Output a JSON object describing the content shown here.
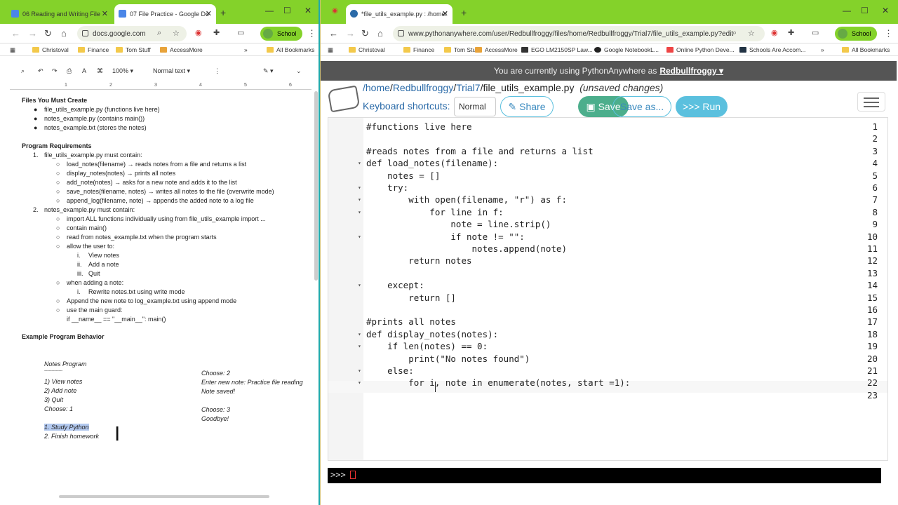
{
  "left": {
    "tabs": [
      {
        "label": "06 Reading and Writing File"
      },
      {
        "label": "07 File Practice - Google Do"
      }
    ],
    "url": "docs.google.com",
    "profile": "School",
    "bookmarks": [
      "Christoval",
      "Finance",
      "Tom Stuff",
      "AccessMore",
      "All Bookmarks"
    ],
    "toolbar": {
      "zoom": "100%",
      "style": "Normal text"
    },
    "ruler": [
      "1",
      "2",
      "3",
      "4",
      "5",
      "6"
    ],
    "doc": {
      "h_files": "Files You Must Create",
      "files": [
        "file_utils_example.py (functions live here)",
        "notes_example.py (contains main())",
        "notes_example.txt (stores the notes)"
      ],
      "h_req": "Program Requirements",
      "r1": "file_utils_example.py must contain:",
      "r1_items": [
        "load_notes(filename) → reads notes from a file and returns a list",
        "display_notes(notes) → prints all notes",
        "add_note(notes) → asks for a new note and adds it to the list",
        "save_notes(filename, notes) → writes all notes to the file (overwrite mode)",
        "append_log(filename, note) → appends the added note to a log file"
      ],
      "r2": "notes_example.py must contain:",
      "r2_items": [
        "import ALL functions individually using from file_utils_example import ...",
        "contain main()",
        "read from notes_example.txt when the program starts",
        "allow the user to:"
      ],
      "r2_sub": [
        "View notes",
        "Add a note",
        "Quit"
      ],
      "r2_sub_n": [
        "i.",
        "ii.",
        "iii."
      ],
      "when": "when adding a note:",
      "rewrite_n": "i.",
      "rewrite": "Rewrite notes.txt using write mode",
      "append": "Append the new note to log_example.txt using append mode",
      "guard": "use the main guard:",
      "guard_code": "if __name__ == \"__main__\": main()",
      "h_ex": "Example Program Behavior",
      "ex_left": [
        "Notes Program",
        "-------------",
        "1) View notes",
        "2) Add note",
        "3) Quit",
        "Choose: 1"
      ],
      "ex_out": [
        "1. Study Python",
        "2. Finish homework"
      ],
      "ex_right": [
        "Choose: 2",
        "Enter new note: Practice file reading",
        "Note saved!",
        "Choose: 3",
        "Goodbye!"
      ]
    }
  },
  "right": {
    "tab": "*file_utils_example.py : /home/",
    "url": "www.pythonanywhere.com/user/Redbullfroggy/files/home/Redbullfroggy/Trial7/file_utils_example.py?edit",
    "profile": "School",
    "bookmarks": [
      "Christoval",
      "Finance",
      "Tom Stuff",
      "AccessMore",
      "EGO LM2150SP Law...",
      "Google NotebookL...",
      "Online Python Deve...",
      "Schools Are Accom...",
      "All Bookmarks"
    ],
    "banner_text": "You are currently using PythonAnywhere as",
    "user": "Redbullfroggy ▾",
    "path": [
      "/home",
      "Redbullfroggy",
      "Trial7",
      "file_utils_example.py"
    ],
    "unsaved": "(unsaved changes)",
    "shortcuts_label": "Keyboard shortcuts:",
    "shortcuts_value": "Normal",
    "buttons": {
      "share": "Share",
      "save": "Save",
      "save_as": "Save as...",
      "run": ">>> Run"
    },
    "console_prompt": ">>>",
    "code": [
      {
        "n": "1",
        "t": "#functions live here",
        "f": ""
      },
      {
        "n": "2",
        "t": "",
        "f": ""
      },
      {
        "n": "3",
        "t": "#reads notes from a file and returns a list",
        "f": ""
      },
      {
        "n": "4",
        "t": "def load_notes(filename):",
        "f": "▾"
      },
      {
        "n": "5",
        "t": "    notes = []",
        "f": ""
      },
      {
        "n": "6",
        "t": "    try:",
        "f": "▾"
      },
      {
        "n": "7",
        "t": "        with open(filename, \"r\") as f:",
        "f": "▾"
      },
      {
        "n": "8",
        "t": "            for line in f:",
        "f": "▾"
      },
      {
        "n": "9",
        "t": "                note = line.strip()",
        "f": ""
      },
      {
        "n": "10",
        "t": "                if note != \"\":",
        "f": "▾"
      },
      {
        "n": "11",
        "t": "                    notes.append(note)",
        "f": ""
      },
      {
        "n": "12",
        "t": "        return notes",
        "f": ""
      },
      {
        "n": "13",
        "t": "",
        "f": ""
      },
      {
        "n": "14",
        "t": "    except:",
        "f": "▾"
      },
      {
        "n": "15",
        "t": "        return []",
        "f": ""
      },
      {
        "n": "16",
        "t": "",
        "f": ""
      },
      {
        "n": "17",
        "t": "#prints all notes",
        "f": ""
      },
      {
        "n": "18",
        "t": "def display_notes(notes):",
        "f": "▾"
      },
      {
        "n": "19",
        "t": "    if len(notes) == 0:",
        "f": "▾"
      },
      {
        "n": "20",
        "t": "        print(\"No notes found\")",
        "f": ""
      },
      {
        "n": "21",
        "t": "    else:",
        "f": "▾"
      },
      {
        "n": "22",
        "t": "        for i, note in enumerate(notes, start =1):",
        "f": "▾"
      },
      {
        "n": "23",
        "t": "",
        "f": ""
      }
    ]
  }
}
